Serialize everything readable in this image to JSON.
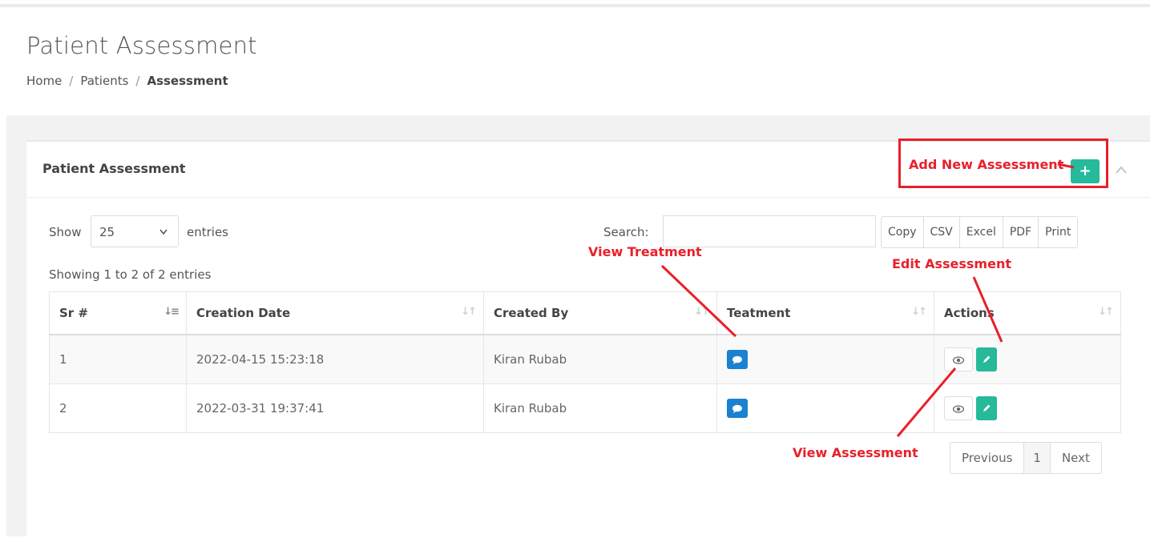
{
  "page": {
    "title": "Patient Assessment",
    "breadcrumb": {
      "home": "Home",
      "patients": "Patients",
      "current": "Assessment",
      "separator": "/"
    }
  },
  "card": {
    "title": "Patient Assessment",
    "add_button_icon": "plus-icon",
    "add_button_glyph": "+",
    "collapse_glyph": "^"
  },
  "toolbar": {
    "show_label": "Show",
    "entries_value": "25",
    "entries_label": "entries",
    "search_label": "Search:",
    "search_value": "",
    "export_buttons": [
      "Copy",
      "CSV",
      "Excel",
      "PDF",
      "Print"
    ]
  },
  "info": "Showing 1 to 2 of 2 entries",
  "table": {
    "headers": [
      "Sr #",
      "Creation Date",
      "Created By",
      "Teatment",
      "Actions"
    ],
    "rows": [
      {
        "sr": "1",
        "date": "2022-04-15 15:23:18",
        "by": "Kiran Rubab"
      },
      {
        "sr": "2",
        "date": "2022-03-31 19:37:41",
        "by": "Kiran Rubab"
      }
    ]
  },
  "pagination": {
    "previous": "Previous",
    "current": "1",
    "next": "Next"
  },
  "annotations": {
    "add_new": "Add New Assessment",
    "view_treatment": "View Treatment",
    "edit_assessment": "Edit Assessment",
    "view_assessment": "View Assessment"
  },
  "colors": {
    "accent_green": "#26b99a",
    "accent_blue": "#1a82d0",
    "annotation_red": "#e8202a"
  }
}
